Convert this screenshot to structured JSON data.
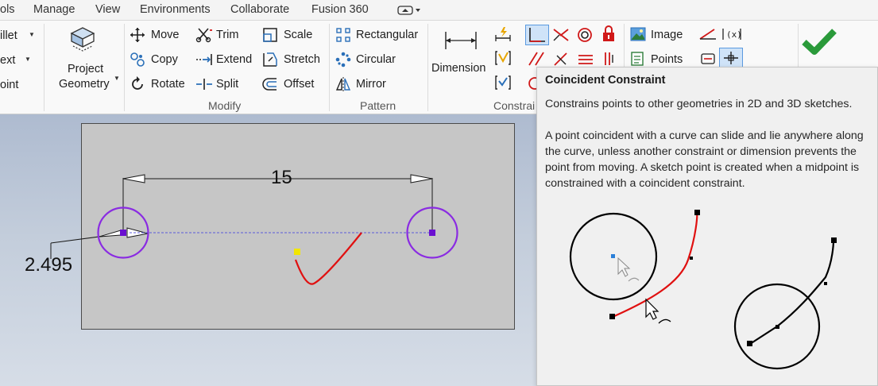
{
  "menubar": {
    "items": [
      "ols",
      "Manage",
      "View",
      "Environments",
      "Collaborate",
      "Fusion 360"
    ]
  },
  "ribbon": {
    "left_partial": {
      "fillet": "illet",
      "text": "ext",
      "point": "oint"
    },
    "project_geometry": {
      "line1": "Project",
      "line2": "Geometry"
    },
    "modify": {
      "group_label": "Modify",
      "move": "Move",
      "copy": "Copy",
      "rotate": "Rotate",
      "trim": "Trim",
      "extend": "Extend",
      "split": "Split",
      "scale": "Scale",
      "stretch": "Stretch",
      "offset": "Offset"
    },
    "pattern": {
      "group_label": "Pattern",
      "rectangular": "Rectangular",
      "circular": "Circular",
      "mirror": "Mirror"
    },
    "constrain": {
      "group_label": "Constrai",
      "dimension": "Dimension"
    },
    "insert": {
      "image": "Image",
      "points": "Points"
    },
    "accent_color": "#1a6fc9",
    "finish_color": "#2a9a3a"
  },
  "canvas": {
    "dim_horizontal": "15",
    "dim_diameter": "2.495",
    "circle_color": "#8a2be2",
    "spline_color": "#e01010",
    "point_color": "#f2e600"
  },
  "tooltip": {
    "title": "Coincident Constraint",
    "summary": "Constrains points to other geometries in 2D and 3D sketches.",
    "description": "A point coincident with a curve can slide and lie anywhere along the curve, unless another constraint or dimension prevents the point from moving. A sketch point is created when a midpoint is constrained with a coincident constraint."
  }
}
